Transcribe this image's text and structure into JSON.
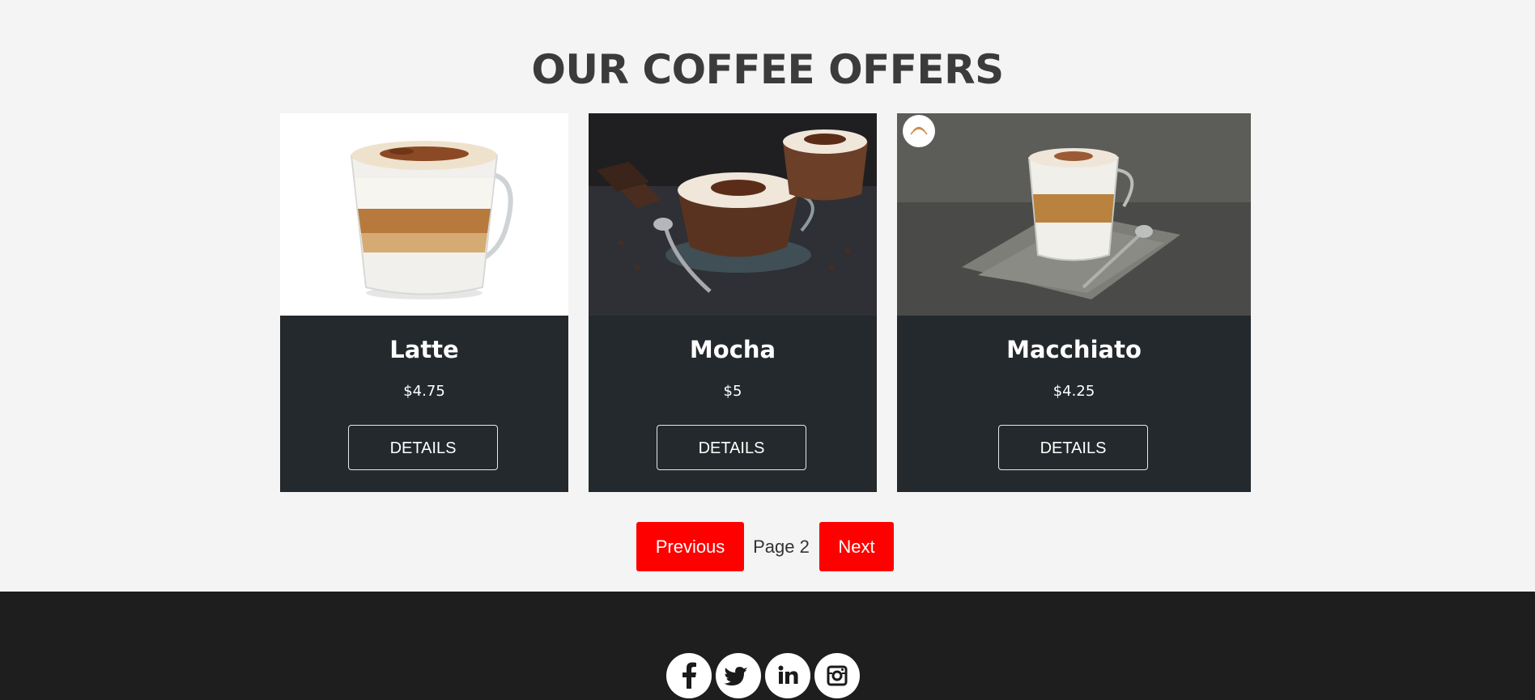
{
  "section": {
    "title": "OUR COFFEE OFFERS"
  },
  "offers": [
    {
      "name": "Latte",
      "price": "$4.75",
      "button": "DETAILS",
      "image": "latte-cup-image"
    },
    {
      "name": "Mocha",
      "price": "$5",
      "button": "DETAILS",
      "image": "mocha-cups-image"
    },
    {
      "name": "Macchiato",
      "price": "$4.25",
      "button": "DETAILS",
      "image": "macchiato-glass-image"
    }
  ],
  "pagination": {
    "previous": "Previous",
    "page": "Page 2",
    "next": "Next"
  },
  "social": [
    "facebook-icon",
    "twitter-icon",
    "linkedin-icon",
    "instagram-icon"
  ],
  "colors": {
    "card_bg": "#23292c",
    "accent": "#ff0000",
    "footer_bg": "#1e1e1e",
    "page_bg": "#f4f4f4"
  }
}
